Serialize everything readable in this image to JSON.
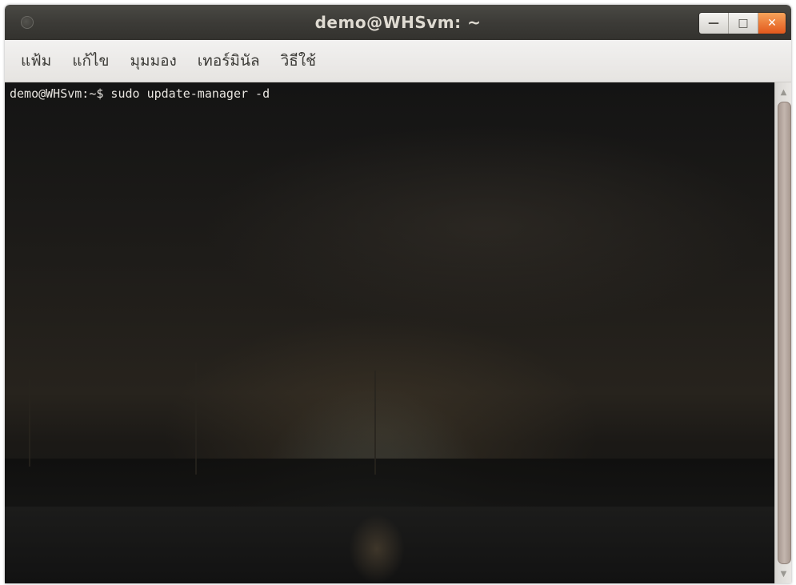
{
  "window": {
    "title": "demo@WHSvm: ~",
    "minimize_glyph": "—",
    "maximize_glyph": "□",
    "close_glyph": "✕"
  },
  "menubar": {
    "items": [
      {
        "label": "แฟ้ม"
      },
      {
        "label": "แก้ไข"
      },
      {
        "label": "มุมมอง"
      },
      {
        "label": "เทอร์มินัล"
      },
      {
        "label": "วิธีใช้"
      }
    ]
  },
  "terminal": {
    "prompt": "demo@WHSvm:~$",
    "command": " sudo update-manager -d"
  },
  "scrollbar": {
    "up_glyph": "▲",
    "down_glyph": "▼"
  },
  "colors": {
    "titlebar": "#3c3b37",
    "close_button": "#e2581c",
    "terminal_text": "#e8e5e0",
    "scroll_thumb": "#b8aaa2"
  }
}
